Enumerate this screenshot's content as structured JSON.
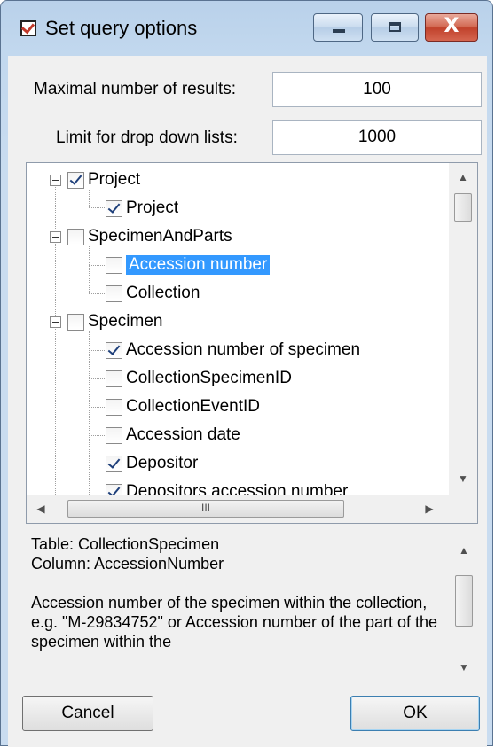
{
  "window": {
    "title": "Set query options",
    "close_glyph": "X"
  },
  "fields": {
    "max_results_label": "Maximal number of results:",
    "max_results_value": "100",
    "dropdown_limit_label": "Limit for drop down lists:",
    "dropdown_limit_value": "1000"
  },
  "tree": {
    "nodes": [
      {
        "label": "Project",
        "checked": true,
        "level": 0
      },
      {
        "label": "Project",
        "checked": true,
        "level": 1
      },
      {
        "label": "SpecimenAndParts",
        "checked": false,
        "level": 0
      },
      {
        "label": "Accession number",
        "checked": false,
        "level": 1,
        "selected": true
      },
      {
        "label": "Collection",
        "checked": false,
        "level": 1
      },
      {
        "label": "Specimen",
        "checked": false,
        "level": 0
      },
      {
        "label": "Accession number of specimen",
        "checked": true,
        "level": 1
      },
      {
        "label": "CollectionSpecimenID",
        "checked": false,
        "level": 1
      },
      {
        "label": "CollectionEventID",
        "checked": false,
        "level": 1
      },
      {
        "label": "Accession date",
        "checked": false,
        "level": 1
      },
      {
        "label": "Depositor",
        "checked": true,
        "level": 1
      },
      {
        "label": "Depositors accession number",
        "checked": true,
        "level": 1
      }
    ],
    "hscroll_grip": "III"
  },
  "description": {
    "line1": "Table: CollectionSpecimen",
    "line2": "Column: AccessionNumber",
    "body": "Accession number of the specimen within the collection, e.g. \"M-29834752\" or Accession number of the part of the specimen within the"
  },
  "buttons": {
    "cancel": "Cancel",
    "ok": "OK"
  }
}
